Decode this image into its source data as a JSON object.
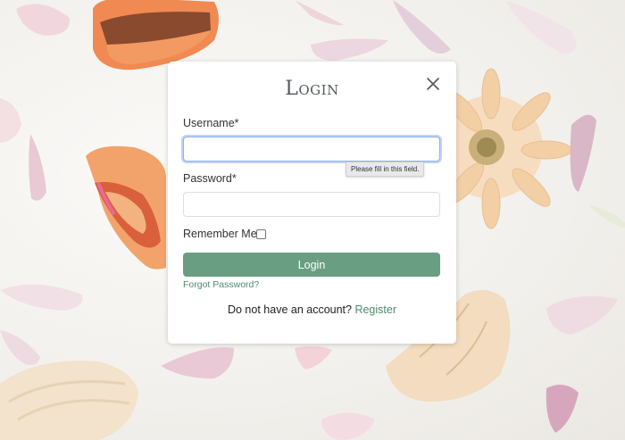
{
  "modal": {
    "title": "Login",
    "close_icon": "close-icon"
  },
  "form": {
    "username_label": "Username*",
    "username_value": "",
    "username_placeholder": "",
    "validation_tooltip": "Please fill in this field.",
    "password_label": "Password*",
    "password_value": "",
    "password_placeholder": "",
    "remember_label": "Remember Me:",
    "remember_checked": false,
    "login_button": "Login",
    "forgot_link": "Forgot Password?",
    "register_prompt": "Do not have an account?",
    "register_link": "Register"
  },
  "colors": {
    "accent": "#6a9e83",
    "link": "#4e8a6c",
    "focus_ring": "#8fb1e9",
    "title": "#555a5f"
  },
  "background": {
    "description_icon": "macarons-and-petals-photo"
  }
}
